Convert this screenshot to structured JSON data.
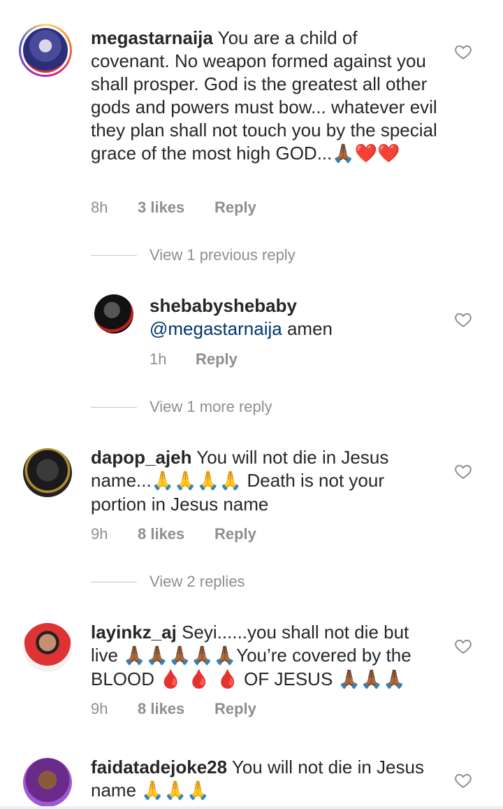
{
  "comments": [
    {
      "username": "megastarnaija",
      "text": "You are a child of covenant. No weapon formed against you shall prosper. God is the greatest all other gods and powers must bow... whatever evil they plan shall not touch you by the special grace of the most high GOD...",
      "emoji": "🙏🏾❤️❤️",
      "time": "8h",
      "likes": "3 likes",
      "reply": "Reply"
    },
    {
      "view_replies": "View 1 previous reply"
    },
    {
      "username": "shebabyshebaby",
      "mention": "@megastarnaija",
      "text": "amen",
      "time": "1h",
      "reply": "Reply"
    },
    {
      "view_replies": "View 1 more reply"
    },
    {
      "username": "dapop_ajeh",
      "text_pre": "You will not die in Jesus name...",
      "emoji": "🙏🙏🙏🙏",
      "text_post": "Death is not your portion in Jesus name",
      "time": "9h",
      "likes": "8 likes",
      "reply": "Reply"
    },
    {
      "view_replies": "View 2 replies"
    },
    {
      "username": "layinkz_aj",
      "text_pre": "Seyi......you shall not die but live",
      "emoji1": "🙏🏾🙏🏾🙏🏾🙏🏾🙏🏾",
      "text_mid": "You’re covered by the BLOOD",
      "emoji2": "🩸 🩸 🩸",
      "text_post": "OF JESUS",
      "emoji3": "🙏🏾🙏🏾🙏🏾",
      "time": "9h",
      "likes": "8 likes",
      "reply": "Reply"
    },
    {
      "username": "faidatadejoke28",
      "text": "You will not die in Jesus name",
      "emoji": "🙏🙏🙏"
    }
  ],
  "icons": {
    "like": "heart-outline-icon"
  },
  "colors": {
    "text": "#262626",
    "muted": "#8e8e8e",
    "mention": "#00376b"
  }
}
